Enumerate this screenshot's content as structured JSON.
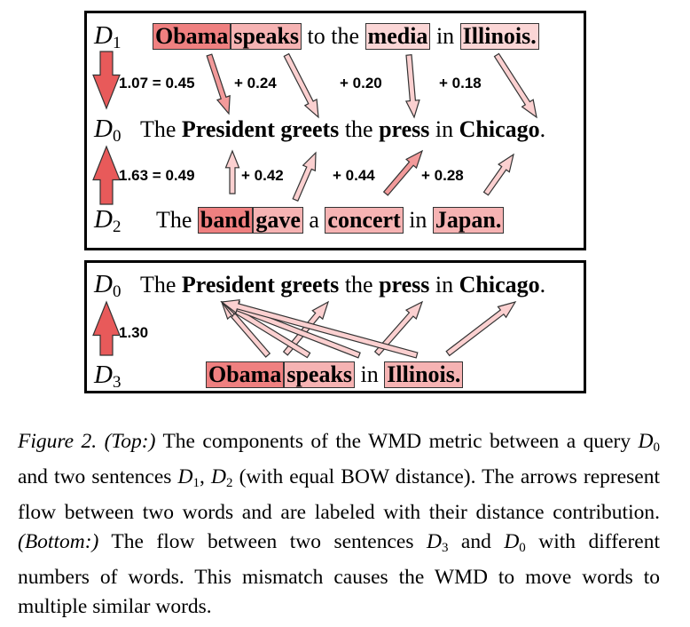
{
  "top": {
    "d1": {
      "label": "D",
      "sub": "1",
      "words": [
        {
          "text": "Obama",
          "shade": "dark"
        },
        {
          "text": "speaks",
          "shade": "mid"
        },
        {
          "text": " to the ",
          "plain": true
        },
        {
          "text": "media",
          "shade": "light"
        },
        {
          "text": " in ",
          "plain": true
        },
        {
          "text": "Illinois.",
          "shade": "light"
        }
      ]
    },
    "d1_numbers": {
      "total": "1.07 = 0.45",
      "n2": "+  0.24",
      "n3": "+  0.20",
      "n4": "+  0.18"
    },
    "d0": {
      "label": "D",
      "sub": "0",
      "text_parts": [
        {
          "text": "The "
        },
        {
          "text": "President",
          "bold": true
        },
        {
          "text": " "
        },
        {
          "text": "greets",
          "bold": true
        },
        {
          "text": " the "
        },
        {
          "text": "press",
          "bold": true
        },
        {
          "text": " in "
        },
        {
          "text": "Chicago",
          "bold": true
        },
        {
          "text": "."
        }
      ]
    },
    "d2_numbers": {
      "total": "1.63 = 0.49",
      "n2": "+ 0.42",
      "n3": "+ 0.44",
      "n4": "+  0.28"
    },
    "d2": {
      "label": "D",
      "sub": "2",
      "lead": "The ",
      "words": [
        {
          "text": "band",
          "shade": "dark"
        },
        {
          "text": "gave",
          "shade": "mid"
        },
        {
          "text": " a ",
          "plain": true
        },
        {
          "text": "concert",
          "shade": "mid"
        },
        {
          "text": " in ",
          "plain": true
        },
        {
          "text": "Japan.",
          "shade": "mid"
        }
      ]
    }
  },
  "bottom": {
    "d0": {
      "label": "D",
      "sub": "0"
    },
    "total": "1.30",
    "d3": {
      "label": "D",
      "sub": "3",
      "words": [
        {
          "text": "Obama",
          "shade": "dark"
        },
        {
          "text": "speaks",
          "shade": "mid"
        },
        {
          "text": " in ",
          "plain": true
        },
        {
          "text": "Illinois.",
          "shade": "mid"
        }
      ]
    }
  },
  "colors": {
    "arrow_dark": "#e85a5a",
    "arrow_mid": "#f29a9a",
    "arrow_light": "#fbd0d0",
    "outline": "#333333"
  },
  "caption": {
    "fig_label": "Figure 2.",
    "top_label": "(Top:)",
    "part1": " The components of the WMD metric between a query ",
    "q_sym": "D",
    "q_sub": "0",
    "part2": " and two sentences ",
    "s1_sym": "D",
    "s1_sub": "1",
    "sep": ", ",
    "s2_sym": "D",
    "s2_sub": "2",
    "part3": " (with equal BOW distance). The arrows represent flow between two words and are labeled with their distance contribution. ",
    "bottom_label": "(Bottom:)",
    "part4": " The flow between two sentences ",
    "b1_sym": "D",
    "b1_sub": "3",
    "part5": " and ",
    "b2_sym": "D",
    "b2_sub": "0",
    "part6": " with different numbers of words. This mismatch causes the WMD to move words to multiple similar words."
  }
}
